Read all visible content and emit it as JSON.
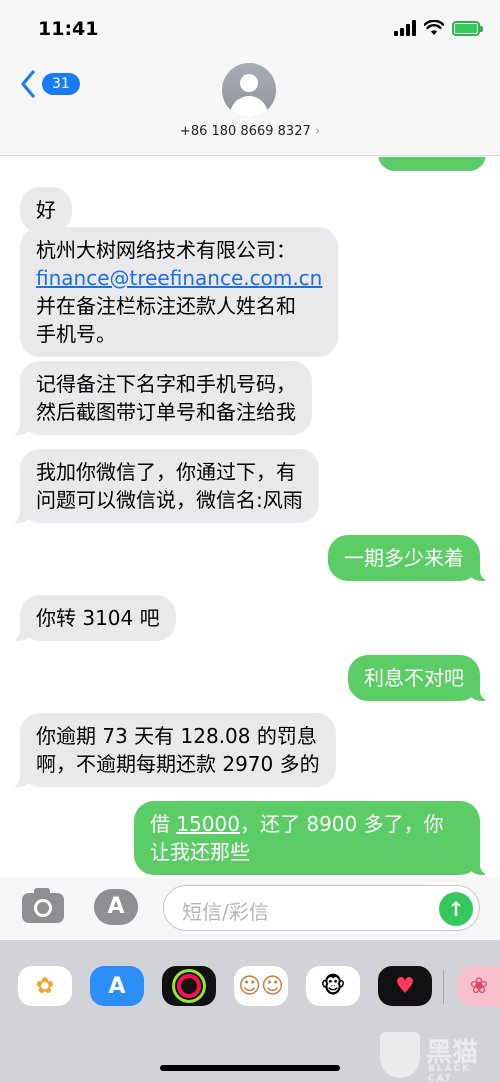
{
  "status": {
    "time": "11:41"
  },
  "header": {
    "back_count": "31",
    "contact": "+86 180 8669 8327",
    "chevron": "›"
  },
  "messages": [
    {
      "dir": "in",
      "text": "好"
    },
    {
      "dir": "in",
      "line1": "杭州大树网络技术有限公司：",
      "link": "finance@treefinance.com.cn",
      "line3": "并在备注栏标注还款人姓名和",
      "line4": "手机号。"
    },
    {
      "dir": "in",
      "line1": "记得备注下名字和手机号码，",
      "line2": "然后截图带订单号和备注给我"
    },
    {
      "dir": "in",
      "line1": "我加你微信了，你通过下，有",
      "line2": "问题可以微信说，微信名:风雨"
    },
    {
      "dir": "out",
      "text": "一期多少来着"
    },
    {
      "dir": "in",
      "text": "你转 3104 吧"
    },
    {
      "dir": "out",
      "text": "利息不对吧"
    },
    {
      "dir": "in",
      "line1": "你逾期 73 天有 128.08 的罚息",
      "line2": "啊，不逾期每期还款 2970 多的"
    },
    {
      "dir": "out",
      "pre": "借 ",
      "amount": "15000",
      "post": "，还了 8900 多了，你",
      "line2": "让我还那些"
    }
  ],
  "input": {
    "placeholder": "短信/彩信",
    "appstore_glyph": "A",
    "send_glyph": "↑"
  },
  "apps": [
    {
      "icon": "photos-icon",
      "glyph": "✿"
    },
    {
      "icon": "app-store-icon",
      "glyph": "A"
    },
    {
      "icon": "activity-rings-icon",
      "glyph": ""
    },
    {
      "icon": "memoji-group-icon",
      "glyph": "☺☺"
    },
    {
      "icon": "animoji-monkey-icon",
      "glyph": "🐵"
    },
    {
      "icon": "digital-touch-heart-icon",
      "glyph": "♥"
    },
    {
      "icon": "sticker-app-icon",
      "glyph": "❀"
    }
  ],
  "watermark": {
    "text": "黑猫",
    "sub": "BLACK CAT"
  },
  "colors": {
    "incoming": "#e9e9eb",
    "outgoing": "#5ccc67",
    "link": "#1a6ef0",
    "ios_blue": "#1a7cf5",
    "send_green": "#34c759"
  }
}
